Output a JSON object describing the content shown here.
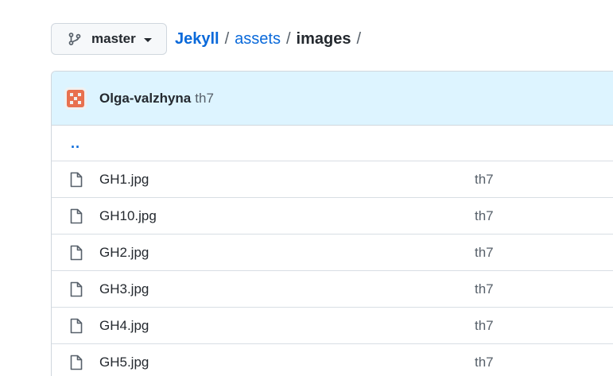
{
  "branch": {
    "label": "master"
  },
  "breadcrumb": {
    "root": "Jekyll",
    "segments": [
      "assets"
    ],
    "current": "images",
    "separator": "/"
  },
  "commit": {
    "author": "Olga-valzhyna",
    "message": "th7"
  },
  "parent_dir": "..",
  "files": [
    {
      "name": "GH1.jpg",
      "commit": "th7"
    },
    {
      "name": "GH10.jpg",
      "commit": "th7"
    },
    {
      "name": "GH2.jpg",
      "commit": "th7"
    },
    {
      "name": "GH3.jpg",
      "commit": "th7"
    },
    {
      "name": "GH4.jpg",
      "commit": "th7"
    },
    {
      "name": "GH5.jpg",
      "commit": "th7"
    }
  ],
  "colors": {
    "link": "#0969da",
    "header_bg": "#ddf4ff",
    "avatar": "#e8704e"
  }
}
